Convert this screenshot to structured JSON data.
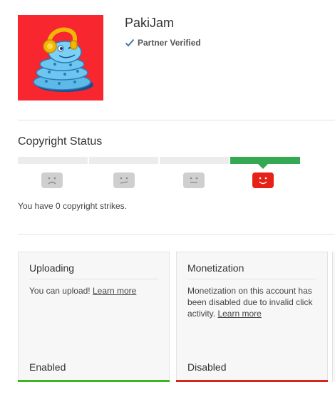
{
  "channel": {
    "name": "PakiJam",
    "verified_label": "Partner Verified",
    "avatar_icon": "snake-with-headphones-mascot-icon",
    "avatar_background": "#f7262f"
  },
  "copyright": {
    "title": "Copyright Status",
    "strike_count": 0,
    "faces": [
      "sad-face-icon",
      "frown-face-icon",
      "neutral-face-icon",
      "happy-face-icon"
    ],
    "active_index": 3,
    "status_text": "You have 0 copyright strikes."
  },
  "cards": {
    "uploading": {
      "title": "Uploading",
      "body": "You can upload! ",
      "link": "Learn more",
      "status": "Enabled",
      "status_color": "#3cb521"
    },
    "monetization": {
      "title": "Monetization",
      "body": "Monetization on this account has been disabled due to invalid click activity. ",
      "link": "Learn more",
      "status": "Disabled",
      "status_color": "#d9261c"
    }
  },
  "colors": {
    "good": "#34a853",
    "bad": "#e62117",
    "neutral_face": "#cfcfcf"
  }
}
